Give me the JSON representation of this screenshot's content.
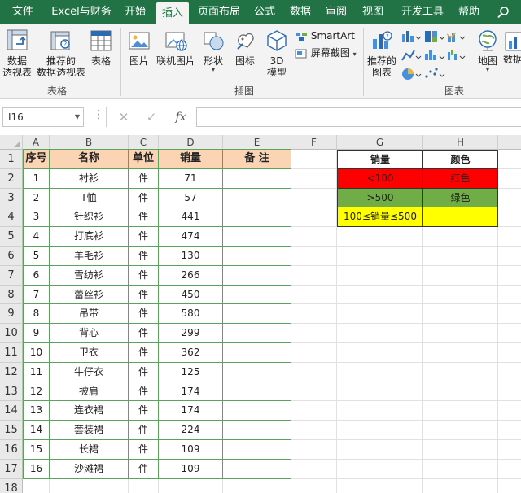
{
  "menu": {
    "tabs": [
      "文件",
      "Excel与财务",
      "开始",
      "插入",
      "页面布局",
      "公式",
      "数据",
      "审阅",
      "视图",
      "开发工具",
      "帮助"
    ],
    "active_tab": "插入"
  },
  "ribbon": {
    "tables": {
      "pivot_table": [
        "数据",
        "透视表"
      ],
      "recommended_pivot": [
        "推荐的",
        "数据透视表"
      ],
      "table": "表格",
      "group_label": "表格"
    },
    "illustrations": {
      "picture": "图片",
      "online_picture": "联机图片",
      "shapes": "形状",
      "icons": "图标",
      "model3d": [
        "3D",
        "模型"
      ],
      "smartart": "SmartArt",
      "screenshot": "屏幕截图",
      "group_label": "插图"
    },
    "charts": {
      "recommended": [
        "推荐的",
        "图表"
      ],
      "map": "地图",
      "pivot_chart_partial": "数据",
      "group_label": "图表"
    }
  },
  "formula_bar": {
    "name_box": "I16",
    "fx": "fx",
    "formula": ""
  },
  "sheet": {
    "columns": [
      "A",
      "B",
      "C",
      "D",
      "E",
      "F",
      "G",
      "H"
    ],
    "rows": [
      "1",
      "2",
      "3",
      "4",
      "5",
      "6",
      "7",
      "8",
      "9",
      "10",
      "11",
      "12",
      "13",
      "14",
      "15",
      "16",
      "17",
      "18"
    ],
    "table_header": [
      "序号",
      "名称",
      "单位",
      "销量",
      "备  注"
    ],
    "table_rows": [
      [
        "1",
        "衬衫",
        "件",
        "71",
        ""
      ],
      [
        "2",
        "T恤",
        "件",
        "57",
        ""
      ],
      [
        "3",
        "针织衫",
        "件",
        "441",
        ""
      ],
      [
        "4",
        "打底衫",
        "件",
        "474",
        ""
      ],
      [
        "5",
        "羊毛衫",
        "件",
        "130",
        ""
      ],
      [
        "6",
        "雪纺衫",
        "件",
        "266",
        ""
      ],
      [
        "7",
        "蕾丝衫",
        "件",
        "450",
        ""
      ],
      [
        "8",
        "吊带",
        "件",
        "580",
        ""
      ],
      [
        "9",
        "背心",
        "件",
        "299",
        ""
      ],
      [
        "10",
        "卫衣",
        "件",
        "362",
        ""
      ],
      [
        "11",
        "牛仔衣",
        "件",
        "125",
        ""
      ],
      [
        "12",
        "披肩",
        "件",
        "174",
        ""
      ],
      [
        "13",
        "连衣裙",
        "件",
        "174",
        ""
      ],
      [
        "14",
        "套装裙",
        "件",
        "224",
        ""
      ],
      [
        "15",
        "长裙",
        "件",
        "109",
        ""
      ],
      [
        "16",
        "沙滩裙",
        "件",
        "109",
        ""
      ]
    ],
    "rule_header": [
      "销量",
      "颜色"
    ],
    "rules": [
      {
        "condition": "<100",
        "color_name": "红色",
        "fill": "#ff0000"
      },
      {
        "condition": ">500",
        "color_name": "绿色",
        "fill": "#70ad47"
      },
      {
        "condition": "100≤销量≤500",
        "color_name": "",
        "fill": "#ffff00"
      }
    ]
  },
  "colors": {
    "excel_green": "#217346",
    "header_fill": "#fbd4b4",
    "table_border": "#5aa35a"
  }
}
